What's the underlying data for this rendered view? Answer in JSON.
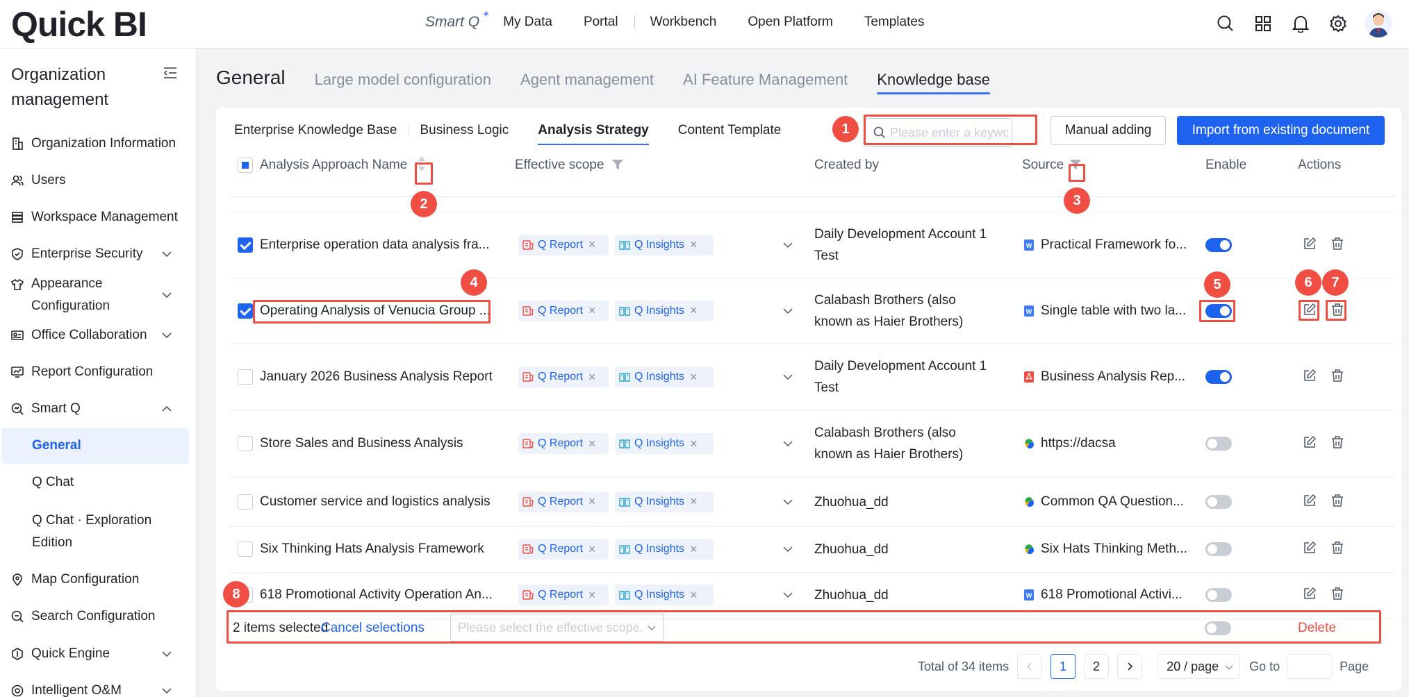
{
  "header": {
    "logo": "Quick BI",
    "nav": {
      "smartq": "Smart Q",
      "items": [
        "My Data",
        "Portal",
        "Workbench",
        "Open Platform",
        "Templates"
      ]
    }
  },
  "sidebar": {
    "title": "Organization management",
    "items": [
      {
        "label": "Organization Information",
        "icon": "building-icon"
      },
      {
        "label": "Users",
        "icon": "users-icon"
      },
      {
        "label": "Workspace Management",
        "icon": "stack-icon"
      },
      {
        "label": "Enterprise Security",
        "icon": "shield-icon"
      },
      {
        "label": "Appearance Configuration",
        "icon": "shirt-icon"
      },
      {
        "label": "Office Collaboration",
        "icon": "id-card-icon"
      },
      {
        "label": "Report Configuration",
        "icon": "report-icon"
      },
      {
        "label": "Smart Q",
        "icon": "smartq-icon"
      },
      {
        "label": "General"
      },
      {
        "label": "Q Chat"
      },
      {
        "label": "Q Chat · Exploration Edition"
      },
      {
        "label": "Map Configuration",
        "icon": "map-pin-icon"
      },
      {
        "label": "Search Configuration",
        "icon": "search-config-icon"
      },
      {
        "label": "Quick Engine",
        "icon": "engine-icon"
      },
      {
        "label": "Intelligent O&M",
        "icon": "om-icon"
      }
    ]
  },
  "main_tabs": [
    "General",
    "Large model configuration",
    "Agent management",
    "AI Feature Management",
    "Knowledge base"
  ],
  "sub_tabs": [
    "Enterprise Knowledge Base",
    "Business Logic",
    "Analysis Strategy",
    "Content Template"
  ],
  "search": {
    "placeholder": "Please enter a keyword."
  },
  "buttons": {
    "manual": "Manual adding",
    "import": "Import from existing document"
  },
  "table": {
    "headers": {
      "name": "Analysis Approach Name",
      "scope": "Effective scope",
      "created_by": "Created by",
      "source": "Source",
      "enable": "Enable",
      "actions": "Actions"
    },
    "tag_labels": {
      "report": "Q Report",
      "insights": "Q Insights"
    },
    "rows": [
      {
        "checked": true,
        "name": "Enterprise operation data analysis fra...",
        "created_by": "Daily Development Account 1 Test",
        "source": "Practical Framework fo...",
        "source_type": "word",
        "enabled": true
      },
      {
        "checked": true,
        "name": "Operating Analysis of Venucia Group ...",
        "created_by": "Calabash Brothers (also known as Haier Brothers)",
        "source": "Single table with two la...",
        "source_type": "word",
        "enabled": true
      },
      {
        "checked": false,
        "name": "January 2026 Business Analysis Report",
        "created_by": "Daily Development Account 1 Test",
        "source": "Business Analysis Rep...",
        "source_type": "pdf",
        "enabled": true
      },
      {
        "checked": false,
        "name": "Store Sales and Business Analysis",
        "created_by": "Calabash Brothers (also known as Haier Brothers)",
        "source": "https://dacsa",
        "source_type": "link",
        "enabled": false
      },
      {
        "checked": false,
        "name": "Customer service and logistics analysis",
        "created_by": "Zhuohua_dd",
        "source": "Common QA Question...",
        "source_type": "link",
        "enabled": false
      },
      {
        "checked": false,
        "name": "Six Thinking Hats Analysis Framework",
        "created_by": "Zhuohua_dd",
        "source": "Six Hats Thinking Meth...",
        "source_type": "link",
        "enabled": false
      },
      {
        "checked": false,
        "name": "618 Promotional Activity Operation An...",
        "created_by": "Zhuohua_dd",
        "source": "618 Promotional Activi...",
        "source_type": "word",
        "enabled": false
      }
    ]
  },
  "bulk": {
    "count": "2 items selected",
    "cancel": "Cancel selections",
    "scope_placeholder": "Please select the effective scope.",
    "delete": "Delete"
  },
  "pagination": {
    "total": "Total of 34 items",
    "pages": [
      "1",
      "2"
    ],
    "page_size": "20 / page",
    "goto": "Go to",
    "page_suffix": "Page"
  },
  "callouts": [
    "1",
    "2",
    "3",
    "4",
    "5",
    "6",
    "7",
    "8"
  ],
  "colors": {
    "primary": "#1e63f0",
    "callout": "#f04d43",
    "danger": "#f04d43"
  }
}
